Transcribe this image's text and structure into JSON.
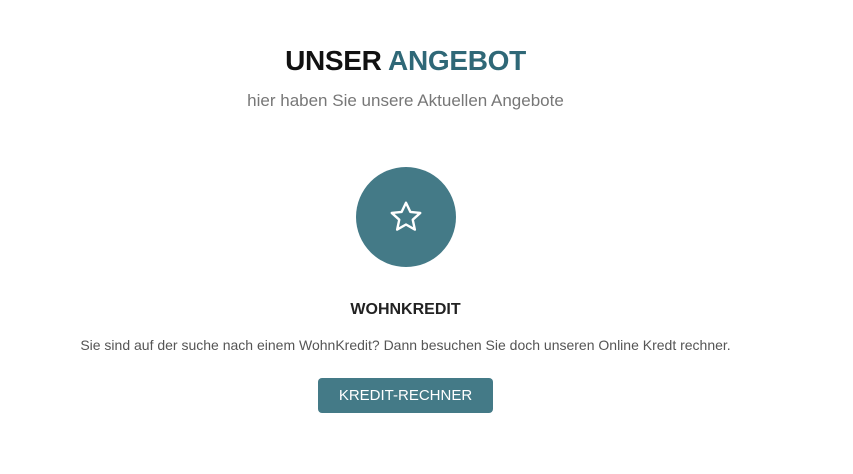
{
  "section": {
    "title_part1": "UNSER",
    "title_part2": "ANGEBOT",
    "subtitle": "hier haben Sie unsere Aktuellen Angebote"
  },
  "offer": {
    "icon": "star-icon",
    "title": "WOHNKREDIT",
    "text": "Sie sind auf der suche nach einem WohnKredit? Dann besuchen Sie doch unseren Online Kredt rechner.",
    "button_label": "KREDIT-RECHNER"
  },
  "colors": {
    "accent": "#2f6877",
    "button": "#447a87",
    "heading": "#111111",
    "subtitle": "#777777"
  }
}
